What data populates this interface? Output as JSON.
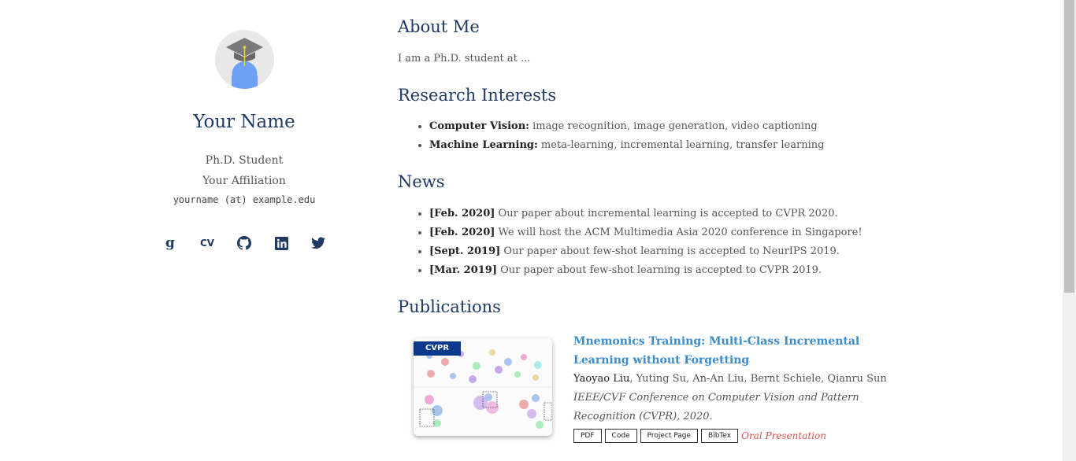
{
  "profile": {
    "name": "Your Name",
    "role": "Ph.D. Student",
    "affiliation": "Your Affiliation",
    "email": "yourname (at) example.edu",
    "socials": [
      {
        "icon": "google-scholar-icon"
      },
      {
        "icon": "cv-icon",
        "label": "CV"
      },
      {
        "icon": "github-icon"
      },
      {
        "icon": "linkedin-icon"
      },
      {
        "icon": "twitter-icon"
      }
    ]
  },
  "about": {
    "heading": "About Me",
    "text": "I am a Ph.D. student at ..."
  },
  "research": {
    "heading": "Research Interests",
    "items": [
      {
        "label": "Computer Vision:",
        "text": " image recognition, image generation, video captioning"
      },
      {
        "label": "Machine Learning:",
        "text": " meta-learning, incremental learning, transfer learning"
      }
    ]
  },
  "news": {
    "heading": "News",
    "items": [
      {
        "date": "[Feb. 2020]",
        "text": " Our paper about incremental learning is accepted to CVPR 2020."
      },
      {
        "date": "[Feb. 2020]",
        "text": " We will host the ACM Multimedia Asia 2020 conference in Singapore!"
      },
      {
        "date": "[Sept. 2019]",
        "text": " Our paper about few-shot learning is accepted to NeurIPS 2019."
      },
      {
        "date": "[Mar. 2019]",
        "text": " Our paper about few-shot learning is accepted to CVPR 2019."
      }
    ]
  },
  "publications": {
    "heading": "Publications",
    "items": [
      {
        "badge": "CVPR",
        "title": "Mnemonics Training: Multi-Class Incremental Learning without Forgetting",
        "first_author": "Yaoyao Liu",
        "other_authors": ", Yuting Su, An-An Liu, Bernt Schiele, Qianru Sun",
        "venue": "IEEE/CVF Conference on Computer Vision and Pattern Recognition (CVPR), 2020.",
        "links": [
          "PDF",
          "Code",
          "Project Page",
          "BibTex"
        ],
        "award": "Oral Presentation"
      }
    ]
  },
  "colors": {
    "heading": "#1f3a63",
    "link": "#3c8dcc",
    "award": "#d9534f",
    "badge": "#0b3a8a",
    "avatar_body": "#6ea0f5",
    "avatar_cap": "#7a7a7a"
  }
}
